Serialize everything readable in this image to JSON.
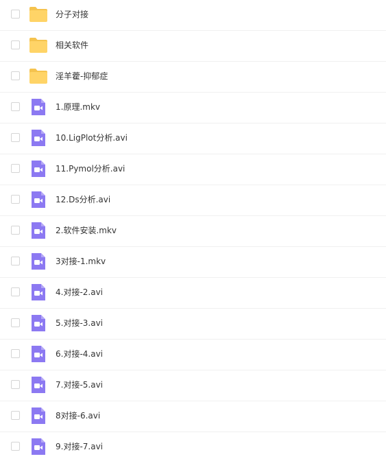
{
  "colors": {
    "folder": "#ffd467",
    "folder_tab": "#f5c34e",
    "video": "#8c79f2",
    "text": "#333333",
    "divider": "#f0f0f0",
    "checkbox_border": "#d5d5d5"
  },
  "files": [
    {
      "name": "分子对接",
      "type": "folder",
      "icon": "folder-icon"
    },
    {
      "name": "相关软件",
      "type": "folder",
      "icon": "folder-icon"
    },
    {
      "name": "淫羊藿-抑郁症",
      "type": "folder",
      "icon": "folder-icon"
    },
    {
      "name": "1.原理.mkv",
      "type": "video",
      "icon": "video-file-icon"
    },
    {
      "name": "10.LigPlot分析.avi",
      "type": "video",
      "icon": "video-file-icon"
    },
    {
      "name": "11.Pymol分析.avi",
      "type": "video",
      "icon": "video-file-icon"
    },
    {
      "name": "12.Ds分析.avi",
      "type": "video",
      "icon": "video-file-icon"
    },
    {
      "name": "2.软件安装.mkv",
      "type": "video",
      "icon": "video-file-icon"
    },
    {
      "name": "3对接-1.mkv",
      "type": "video",
      "icon": "video-file-icon"
    },
    {
      "name": "4.对接-2.avi",
      "type": "video",
      "icon": "video-file-icon"
    },
    {
      "name": "5.对接-3.avi",
      "type": "video",
      "icon": "video-file-icon"
    },
    {
      "name": "6.对接-4.avi",
      "type": "video",
      "icon": "video-file-icon"
    },
    {
      "name": "7.对接-5.avi",
      "type": "video",
      "icon": "video-file-icon"
    },
    {
      "name": "8对接-6.avi",
      "type": "video",
      "icon": "video-file-icon"
    },
    {
      "name": "9.对接-7.avi",
      "type": "video",
      "icon": "video-file-icon"
    }
  ]
}
